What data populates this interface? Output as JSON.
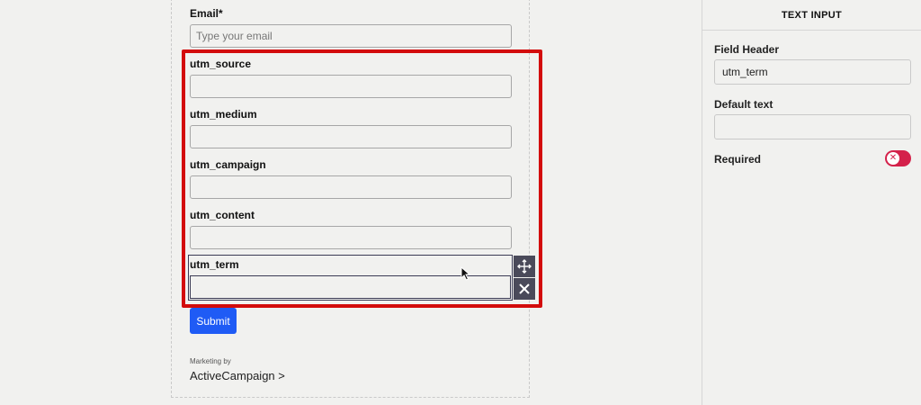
{
  "form": {
    "email": {
      "label": "Email*",
      "placeholder": "Type your email"
    },
    "fields": [
      {
        "label": "utm_source",
        "value": ""
      },
      {
        "label": "utm_medium",
        "value": ""
      },
      {
        "label": "utm_campaign",
        "value": ""
      },
      {
        "label": "utm_content",
        "value": ""
      },
      {
        "label": "utm_term",
        "value": ""
      }
    ],
    "submit_label": "Submit",
    "marketing_by": "Marketing by",
    "brand": "ActiveCampaign >"
  },
  "field_toolbar": {
    "move_icon": "move-icon",
    "delete_icon": "close-icon"
  },
  "panel": {
    "title": "TEXT INPUT",
    "field_header_label": "Field Header",
    "field_header_value": "utm_term",
    "default_text_label": "Default text",
    "default_text_value": "",
    "required_label": "Required",
    "required_on": false
  },
  "colors": {
    "accent": "#1f5bf5",
    "highlight": "#d30c0c",
    "toggle_off": "#d4214a",
    "toolbar": "#4a4a5a"
  }
}
